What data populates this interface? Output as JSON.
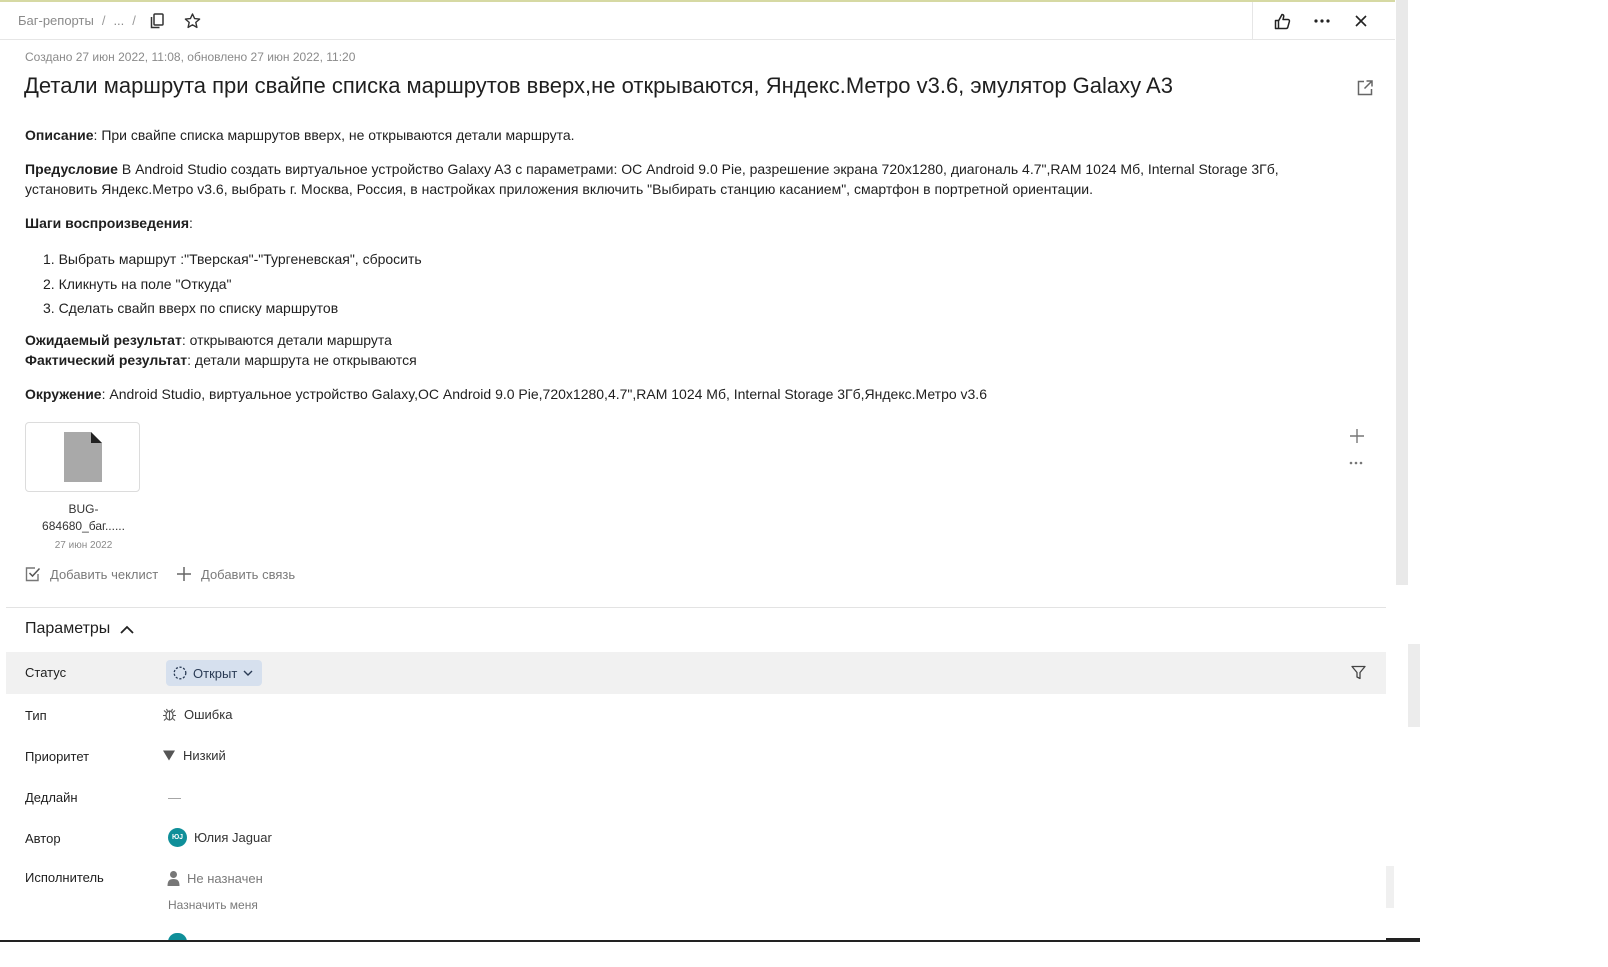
{
  "topbar": {
    "breadcrumbs": [
      "Баг-репорты",
      "..."
    ],
    "separator": "/"
  },
  "meta": "Создано 27 июн 2022, 11:08, обновлено 27 июн 2022, 11:20",
  "title": "Детали маршрута при свайпе списка маршрутов вверх,не открываются, Яндекс.Метро v3.6, эмулятор Galaxy A3",
  "description": {
    "desc_label": "Описание",
    "desc_text": ": При свайпе списка маршрутов вверх, не открываются детали маршрута.",
    "pre_label": "Предусловие",
    "pre_text": " В Android Studio создать виртуальное устройство Galaxy A3 с параметрами: ОС Android 9.0 Pie, разрешение экрана 720x1280, диагональ 4.7\",RAM 1024 Мб, Internal Storage 3Гб, установить Яндекс.Метро v3.6, выбрать г. Москва, Россия, в настройках приложения включить \"Выбирать станцию касанием\", смартфон в портретной ориентации.",
    "steps_label": "Шаги воспроизведения",
    "steps_colon": ":",
    "steps": [
      "1. Выбрать маршрут :\"Тверская\"-\"Тургеневская\", сбросить",
      "2. Кликнуть на поле \"Откуда\"",
      "3. Сделать свайп вверх по списку маршрутов"
    ],
    "expected_label": "Ожидаемый результат",
    "expected_text": ": открываются детали маршрута",
    "actual_label": "Фактический результат",
    "actual_text": ": детали маршрута не открываются",
    "env_label": "Окружение",
    "env_text": ": Android Studio, виртуальное устройство Galaxy,ОС Android 9.0 Pie,720x1280,4.7\",RAM 1024 Мб, Internal Storage 3Гб,Яндекс.Метро v3.6"
  },
  "attachment": {
    "name_line1": "BUG-",
    "name_line2": "684680_баг......",
    "date": "27 июн 2022"
  },
  "actions": {
    "add_checklist": "Добавить чеклист",
    "add_link": "Добавить связь"
  },
  "params": {
    "section_title": "Параметры",
    "status_label": "Статус",
    "status_value": "Открыт",
    "type_label": "Тип",
    "type_value": "Ошибка",
    "priority_label": "Приоритет",
    "priority_value": "Низкий",
    "deadline_label": "Дедлайн",
    "deadline_value": "—",
    "author_label": "Автор",
    "author_initials": "ЮJ",
    "author_value": "Юлия Jaguar",
    "assignee_label": "Исполнитель",
    "assignee_value": "Не назначен",
    "assign_me": "Назначить меня"
  },
  "colors": {
    "accent_status_bg": "#d6e0ee",
    "avatar_bg": "#0f8f99"
  }
}
